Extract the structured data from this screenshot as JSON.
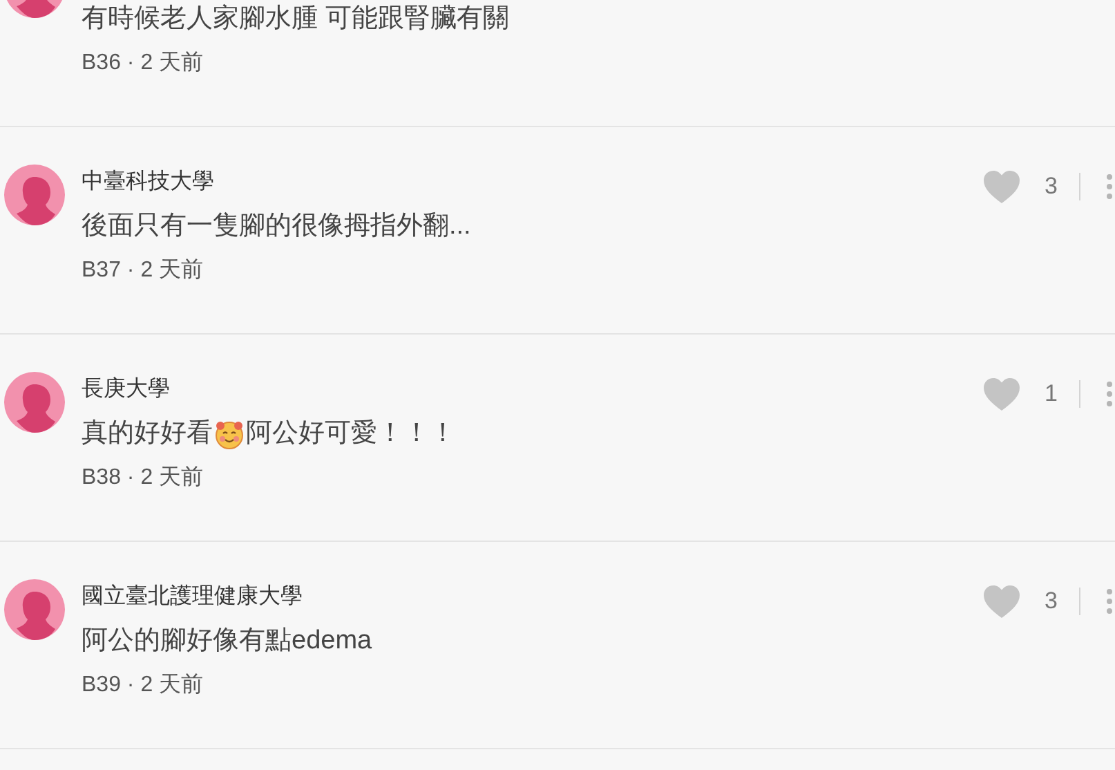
{
  "comments": [
    {
      "body": [
        {
          "kind": "text",
          "text": "有時候老人家腳水腫 可能跟腎臟有關"
        }
      ],
      "meta": "B36 · 2 天前"
    },
    {
      "author": "中臺科技大學",
      "body": [
        {
          "kind": "text",
          "text": "後面只有一隻腳的很像拇指外翻..."
        }
      ],
      "meta": "B37 · 2 天前",
      "likes": "3"
    },
    {
      "author": "長庚大學",
      "body": [
        {
          "kind": "text",
          "text": "真的好好看"
        },
        {
          "kind": "emoji"
        },
        {
          "kind": "text",
          "text": "阿公好可愛！！！"
        }
      ],
      "meta": "B38 · 2 天前",
      "likes": "1"
    },
    {
      "author": "國立臺北護理健康大學",
      "body": [
        {
          "kind": "text",
          "text": "阿公的腳好像有點edema"
        }
      ],
      "meta": "B39 · 2 天前",
      "likes": "3"
    }
  ]
}
